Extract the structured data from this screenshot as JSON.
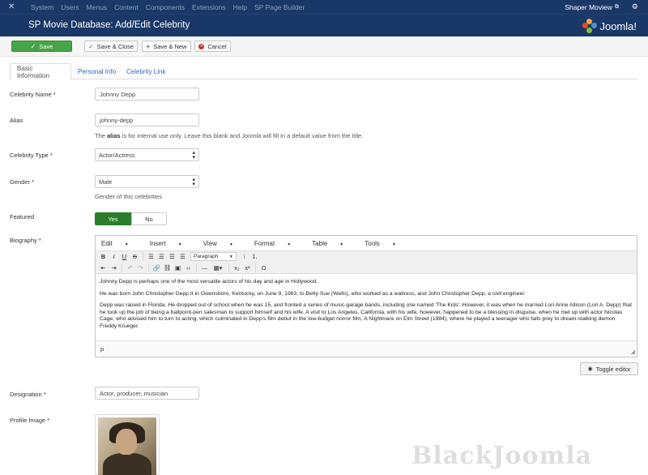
{
  "topbar": {
    "menu": [
      "System",
      "Users",
      "Menus",
      "Content",
      "Components",
      "Extensions",
      "Help",
      "SP Page Builder"
    ],
    "site_link": "Shaper Moview"
  },
  "header": {
    "title": "SP Movie Database: Add/Edit Celebrity",
    "brand": "Joomla!"
  },
  "toolbar": {
    "save_label": "Save",
    "save_close_label": "Save & Close",
    "save_new_label": "Save & New",
    "cancel_label": "Cancel"
  },
  "tabs": [
    "Basic Information",
    "Personal Info",
    "Celebrity Link"
  ],
  "form": {
    "celebrity_name": {
      "label": "Celebrity Name *",
      "value": "Johnny Depp"
    },
    "alias": {
      "label": "Alias",
      "value": "johnny-depp",
      "help_pre": "The ",
      "help_bold": "alias",
      "help_post": " is for internal use only. Leave this blank and Joomla will fill in a default value from the title."
    },
    "celebrity_type": {
      "label": "Celebrity Type *",
      "value": "Actor/Actress"
    },
    "gender": {
      "label": "Gender *",
      "value": "Male",
      "help": "Gender of this celebrities"
    },
    "featured": {
      "label": "Featured",
      "yes": "Yes",
      "no": "No",
      "selected": "Yes"
    },
    "biography": {
      "label": "Biography *"
    },
    "designation": {
      "label": "Designation *",
      "value": "Actor, producer, musician"
    },
    "profile_image": {
      "label": "Profile Image *"
    }
  },
  "editor": {
    "menus": [
      "Edit",
      "Insert",
      "View",
      "Format",
      "Table",
      "Tools"
    ],
    "format_select": "Paragraph",
    "paragraphs": [
      "Johnny Depp is perhaps one of the most versatile actors of his day and age in Hollywood.",
      "He was born John Christopher Depp II in Owensboro, Kentucky, on June 9, 1963, to Betty Sue (Wells), who worked as a waitress, and John Christopher Depp, a civil engineer.",
      "Depp was raised in Florida. He dropped out of school when he was 15, and fronted a series of music-garage bands, including one named 'The Kids'. However, it was when he married Lori Anne Allison (Lori A. Depp) that he took up the job of being a ballpoint-pen salesman to support himself and his wife. A visit to Los Angeles, California, with his wife, however, happened to be a blessing in disguise, when he met up with actor Nicolas Cage, who advised him to turn to acting, which culminated in Depp's film debut in the low-budget horror film, A Nightmare on Elm Street (1984), where he played a teenager who falls prey to dream-stalking demon Freddy Krueger."
    ],
    "status_path": "p",
    "toggle_label": "Toggle editor"
  },
  "watermark": "BlackJoomla",
  "colors": {
    "header_bg": "#1a3867",
    "save_green": "#46a546",
    "toggle_yes": "#2a7d2a",
    "link_blue": "#2a69b8"
  }
}
